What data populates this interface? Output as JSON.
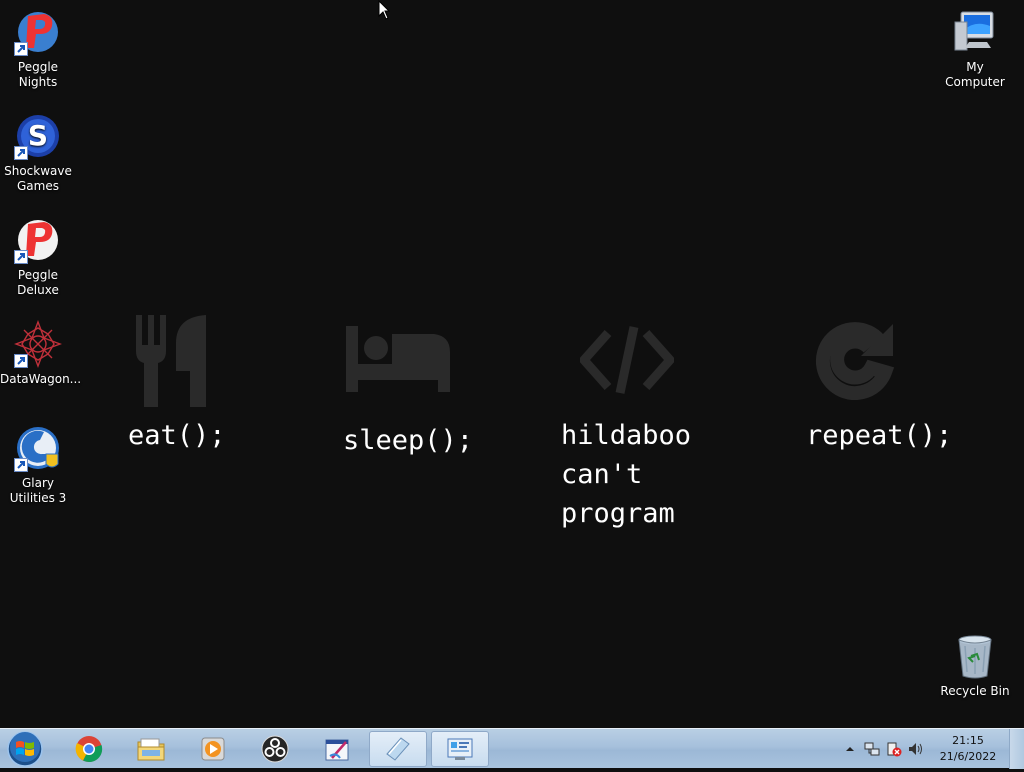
{
  "desktop_icons": [
    {
      "label": "Peggle Nights"
    },
    {
      "label": "Shockwave Games"
    },
    {
      "label": "Peggle Deluxe"
    },
    {
      "label": "DataWagon..."
    },
    {
      "label": "Glary Utilities 3"
    },
    {
      "label": "My Computer"
    },
    {
      "label": "Recycle Bin"
    }
  ],
  "wallpaper": {
    "items": [
      {
        "icon": "fork-knife-icon",
        "text": "eat();"
      },
      {
        "icon": "bed-icon",
        "text": "sleep();"
      },
      {
        "icon": "code-icon",
        "text": "hildaboo\ncan't\nprogram"
      },
      {
        "icon": "repeat-icon",
        "text": "repeat();"
      }
    ],
    "icon_color": "#2a2a2a",
    "background": "#0f0f0f"
  },
  "taskbar": {
    "start_icon": "windows-orb-icon",
    "pinned": [
      {
        "icon": "chrome-icon"
      },
      {
        "icon": "file-explorer-icon"
      },
      {
        "icon": "media-player-icon"
      },
      {
        "icon": "obs-icon"
      },
      {
        "icon": "paint-app-icon"
      },
      {
        "icon": "notepad-icon"
      },
      {
        "icon": "control-panel-icon"
      }
    ],
    "tray": {
      "show_hidden_icon": "up-arrow-icon",
      "network_icon": "network-icon",
      "action_center_icon": "action-center-icon",
      "volume_icon": "volume-icon"
    },
    "clock": {
      "time": "21:15",
      "date": "21/6/2022"
    }
  }
}
